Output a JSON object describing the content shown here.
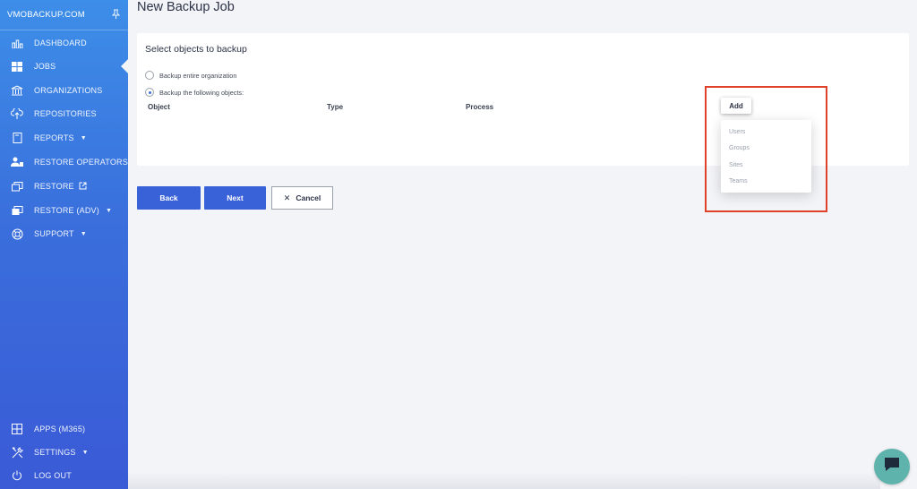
{
  "brand": {
    "name": "VMOBACKUP.COM",
    "pin_icon": "pin-icon"
  },
  "sidebar": {
    "items": [
      {
        "label": "DASHBOARD",
        "icon": "bar-chart-icon"
      },
      {
        "label": "JOBS",
        "icon": "windows-icon"
      },
      {
        "label": "ORGANIZATIONS",
        "icon": "bank-icon"
      },
      {
        "label": "REPOSITORIES",
        "icon": "cloud-upload-icon"
      },
      {
        "label": "REPORTS",
        "icon": "report-icon"
      },
      {
        "label": "RESTORE OPERATORS",
        "icon": "users-icon"
      },
      {
        "label": "RESTORE",
        "icon": "restore-icon"
      },
      {
        "label": "RESTORE (ADV)",
        "icon": "restore-adv-icon"
      },
      {
        "label": "SUPPORT",
        "icon": "lifebuoy-icon"
      }
    ],
    "bottom_items": [
      {
        "label": "APPS (M365)",
        "icon": "grid-icon"
      },
      {
        "label": "SETTINGS",
        "icon": "tools-icon"
      },
      {
        "label": "LOG OUT",
        "icon": "power-icon"
      }
    ],
    "active": "JOBS"
  },
  "page": {
    "title": "New Backup Job",
    "section_title": "Select objects to backup",
    "options": [
      {
        "label": "Backup entire organization",
        "checked": false
      },
      {
        "label": "Backup the following objects:",
        "checked": true
      }
    ],
    "columns": [
      "Object",
      "Type",
      "Process"
    ],
    "add_label": "Add",
    "add_menu": [
      "Users",
      "Groups",
      "Sites",
      "Teams"
    ]
  },
  "footer_buttons": {
    "back": "Back",
    "next": "Next",
    "cancel": "Cancel"
  },
  "colors": {
    "accent": "#3a62d8",
    "highlight": "#e0412b",
    "chat": "#5fb3ad"
  }
}
